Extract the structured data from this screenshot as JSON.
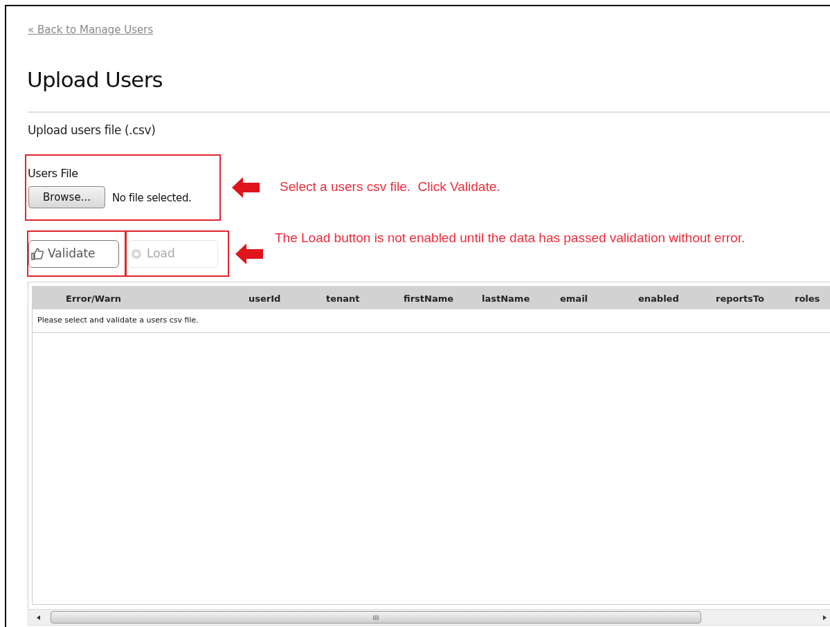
{
  "back_link": "« Back to Manage Users",
  "title": "Upload Users",
  "section_title": "Upload users file (.csv)",
  "file_field": {
    "label": "Users File",
    "button": "Browse...",
    "status": "No file selected."
  },
  "buttons": [
    {
      "label": "Validate",
      "disabled": false
    },
    {
      "label": "Load",
      "disabled": true
    }
  ],
  "table": {
    "columns": [
      "Error/Warn",
      "userId",
      "tenant",
      "firstName",
      "lastName",
      "email",
      "enabled",
      "reportsTo",
      "roles"
    ],
    "message": "Please select and validate a users csv file."
  },
  "annotations": [
    {
      "text": "Select a users csv file.  Click Validate."
    },
    {
      "text": "The Load button is not enabled until the data has passed validation without error."
    }
  ]
}
